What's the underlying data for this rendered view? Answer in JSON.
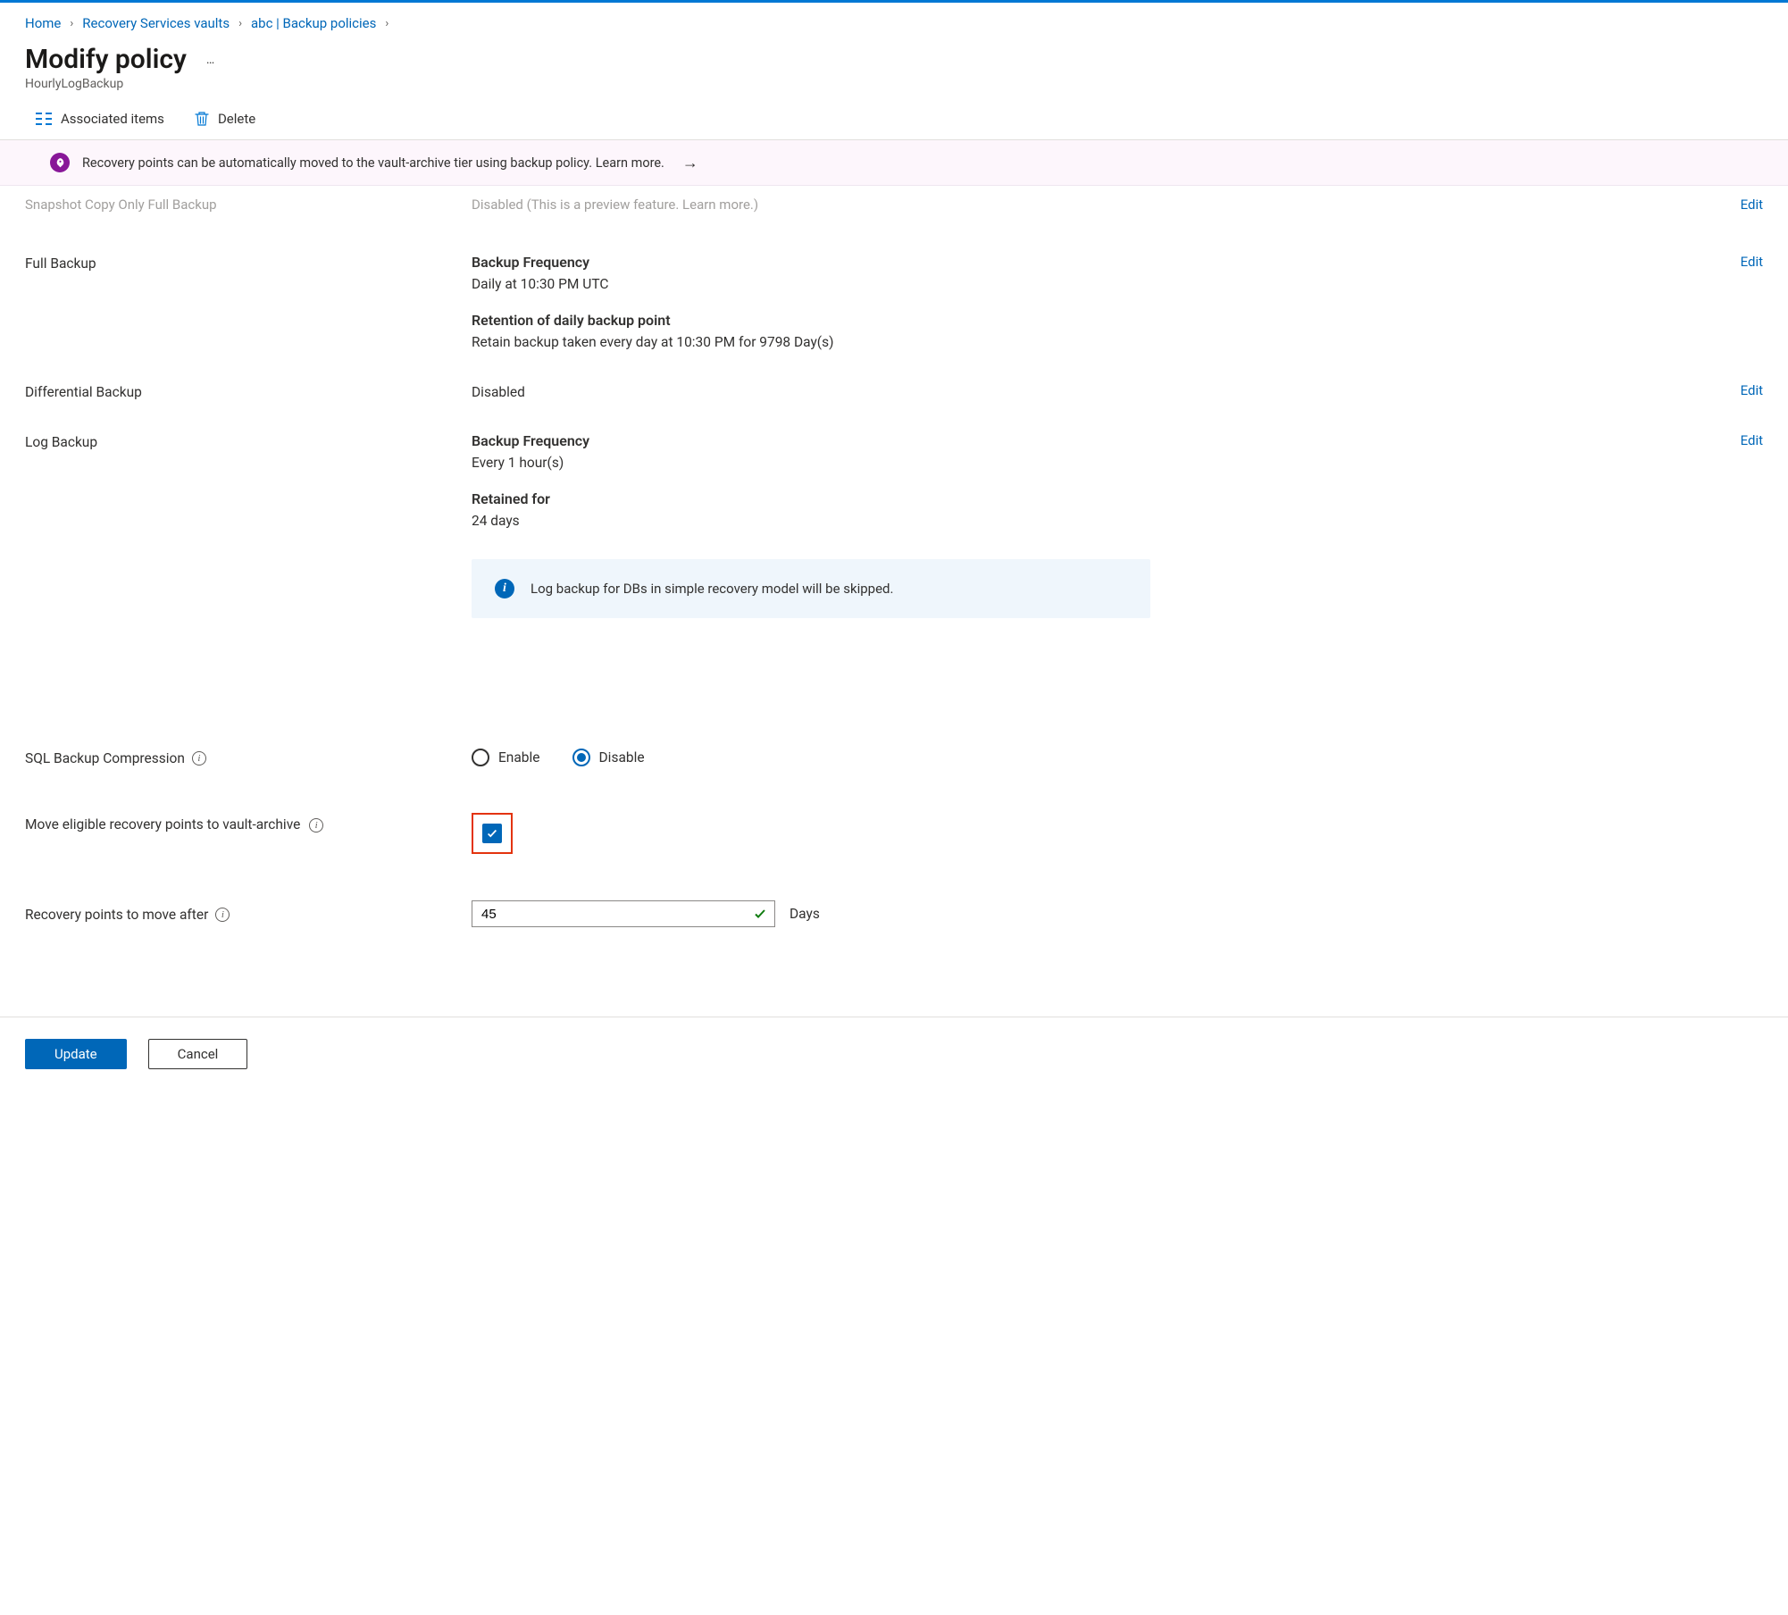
{
  "breadcrumb": {
    "items": [
      "Home",
      "Recovery Services vaults",
      "abc | Backup policies"
    ]
  },
  "header": {
    "title": "Modify policy",
    "more": "…",
    "subtitle": "HourlyLogBackup"
  },
  "toolbar": {
    "associated": "Associated items",
    "delete": "Delete"
  },
  "notice": {
    "text": "Recovery points can be automatically moved to the vault-archive tier using backup policy. Learn more.",
    "arrow": "→"
  },
  "snapshot": {
    "label": "Snapshot Copy Only Full Backup",
    "value": "Disabled (This is a preview feature. Learn more.)",
    "edit": "Edit"
  },
  "full": {
    "label": "Full Backup",
    "freq_h": "Backup Frequency",
    "freq_v": "Daily at 10:30 PM UTC",
    "ret_h": "Retention of daily backup point",
    "ret_v": "Retain backup taken every day at 10:30 PM for 9798 Day(s)",
    "edit": "Edit"
  },
  "diff": {
    "label": "Differential Backup",
    "value": "Disabled",
    "edit": "Edit"
  },
  "log": {
    "label": "Log Backup",
    "freq_h": "Backup Frequency",
    "freq_v": "Every 1 hour(s)",
    "ret_h": "Retained for",
    "ret_v": "24 days",
    "callout": "Log backup for DBs in simple recovery model will be skipped.",
    "edit": "Edit"
  },
  "compression": {
    "label": "SQL Backup Compression",
    "enable": "Enable",
    "disable": "Disable",
    "selected": "disable"
  },
  "archive": {
    "label": "Move eligible recovery points to vault-archive",
    "checked": true
  },
  "moveafter": {
    "label": "Recovery points to move after",
    "value": "45",
    "unit": "Days"
  },
  "footer": {
    "update": "Update",
    "cancel": "Cancel"
  }
}
